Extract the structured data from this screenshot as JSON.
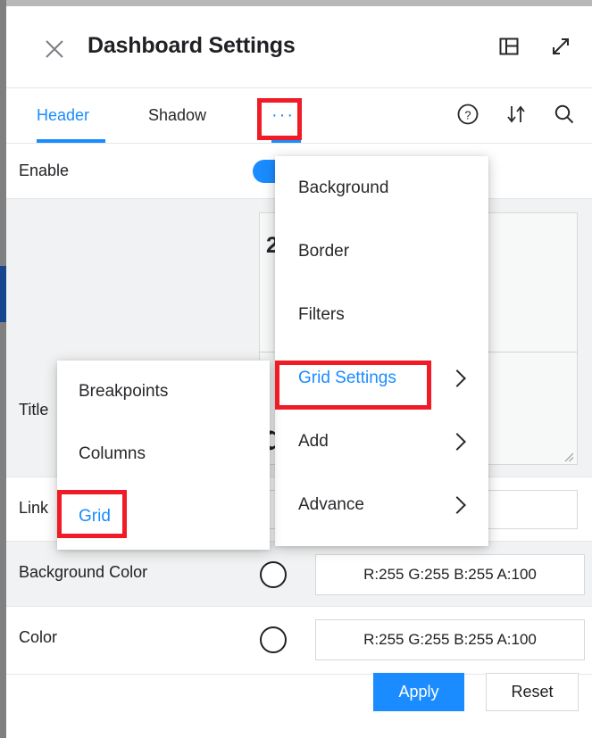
{
  "window": {
    "title": "Dashboard Settings",
    "close_icon": "close-icon",
    "panel_icon": "panel-layout-icon",
    "expand_icon": "expand-arrows-icon"
  },
  "tabs": {
    "items": [
      {
        "label": "Header",
        "active": true
      },
      {
        "label": "Shadow",
        "active": false
      },
      {
        "label": "···",
        "active": true
      }
    ],
    "actions": [
      {
        "name": "help-icon",
        "label": "?"
      },
      {
        "name": "sort-icon",
        "label": ""
      },
      {
        "name": "search-icon",
        "label": ""
      }
    ]
  },
  "settings": {
    "rows": [
      {
        "label": "Enable",
        "type": "toggle",
        "value": "on"
      },
      {
        "label": "Title",
        "type": "textarea"
      },
      {
        "label": "Link",
        "type": "input",
        "value": ""
      },
      {
        "label": "Background Color",
        "type": "color",
        "value": "R:255 G:255 B:255 A:100"
      },
      {
        "label": "Color",
        "type": "color",
        "value": "R:255 G:255 B:255 A:100"
      }
    ],
    "textarea_fragments": {
      "superscript": "2",
      "big_letter": "d"
    }
  },
  "buttons": {
    "apply": "Apply",
    "reset": "Reset"
  },
  "menus": {
    "main": {
      "items": [
        {
          "label": "Background",
          "submenu": false,
          "selected": false
        },
        {
          "label": "Border",
          "submenu": false,
          "selected": false
        },
        {
          "label": "Filters",
          "submenu": false,
          "selected": false
        },
        {
          "label": "Grid Settings",
          "submenu": true,
          "selected": true
        },
        {
          "label": "Add",
          "submenu": true,
          "selected": false
        },
        {
          "label": "Advance",
          "submenu": true,
          "selected": false
        }
      ]
    },
    "sub": {
      "items": [
        {
          "label": "Breakpoints",
          "selected": false
        },
        {
          "label": "Columns",
          "selected": false
        },
        {
          "label": "Grid",
          "selected": true
        }
      ]
    }
  },
  "colors": {
    "accent": "#1a8cff",
    "highlight_box": "#ef1b26",
    "scrollbar": "#17458f",
    "text": "#202124"
  }
}
